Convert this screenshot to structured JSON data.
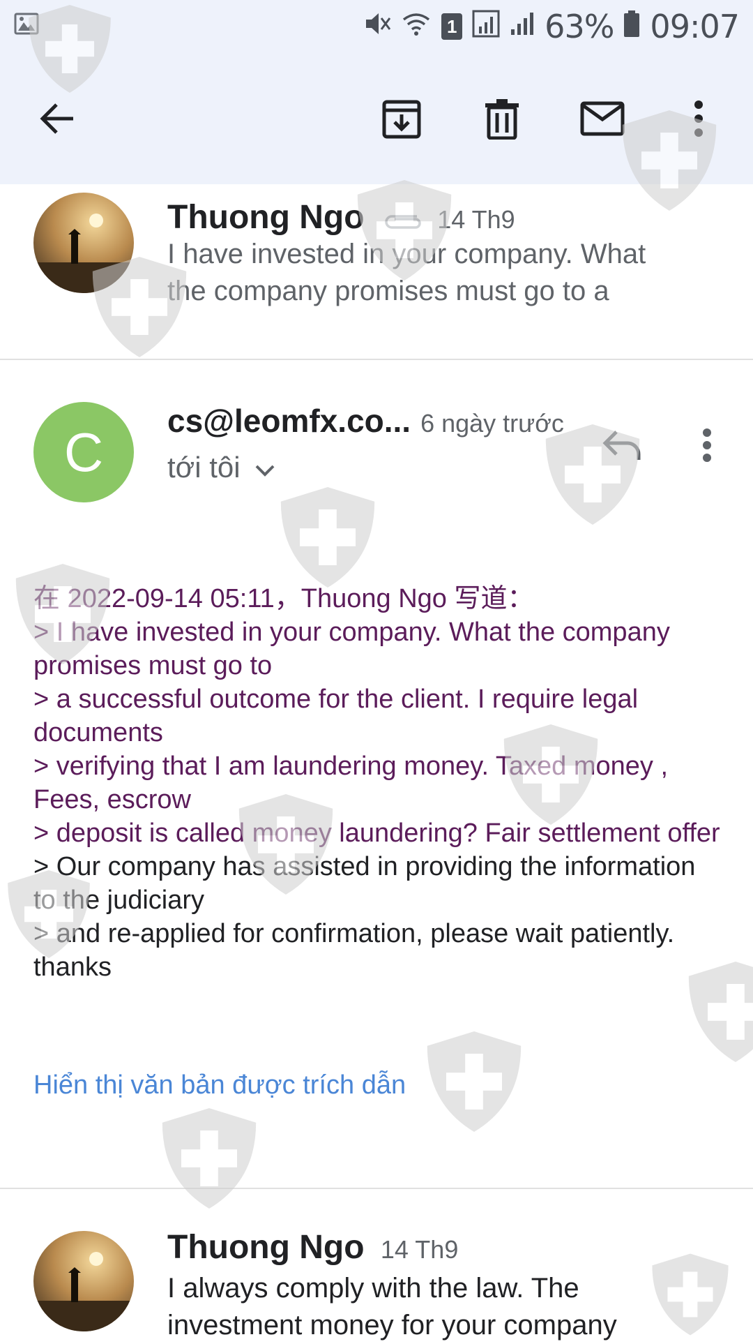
{
  "status_bar": {
    "badge": "1",
    "battery_percent": "63%",
    "time": "09:07",
    "icons": [
      "image-icon",
      "mute-icon",
      "wifi-icon",
      "sim-badge-icon",
      "signal-icon",
      "signal-icon",
      "battery-icon"
    ]
  },
  "toolbar": {
    "icons": [
      "back-arrow-icon",
      "archive-icon",
      "delete-icon",
      "mark-unread-icon",
      "more-vert-icon"
    ]
  },
  "messages": [
    {
      "sender": "Thuong Ngo",
      "date": "14 Th9",
      "has_attachment": true,
      "snippet": "I have invested in your company. What the company promises must go to a"
    },
    {
      "avatar_letter": "C",
      "avatar_color": "#8bc765",
      "sender": "cs@leomfx.co...",
      "date": "6 ngày trước",
      "to_line": "tới tôi",
      "body_lines": [
        {
          "text": "在 2022-09-14 05:11，Thuong Ngo 写道：",
          "quoted": true
        },
        {
          "text": "> I have invested in your company. What the company promises must go to",
          "quoted": true
        },
        {
          "text": "> a successful outcome for the client. I require legal documents",
          "quoted": true
        },
        {
          "text": "> verifying that I am laundering money. Taxed money , Fees, escrow",
          "quoted": true
        },
        {
          "text": "> deposit is called money laundering? Fair settlement offer",
          "quoted": true
        },
        {
          "text": "> Our company has assisted in providing the information to the judiciary",
          "quoted": false
        },
        {
          "text": "> and re-applied for confirmation, please wait patiently. thanks",
          "quoted": false
        }
      ],
      "show_quoted_label": "Hiển thị văn bản được trích dẫn"
    },
    {
      "sender": "Thuong Ngo",
      "date": "14 Th9",
      "snippet": "I always comply with the law. The investment money for your company"
    }
  ],
  "colors": {
    "header_bg": "#eef2fb",
    "quoted_text": "#5b1c5a",
    "link": "#4a86d6"
  }
}
